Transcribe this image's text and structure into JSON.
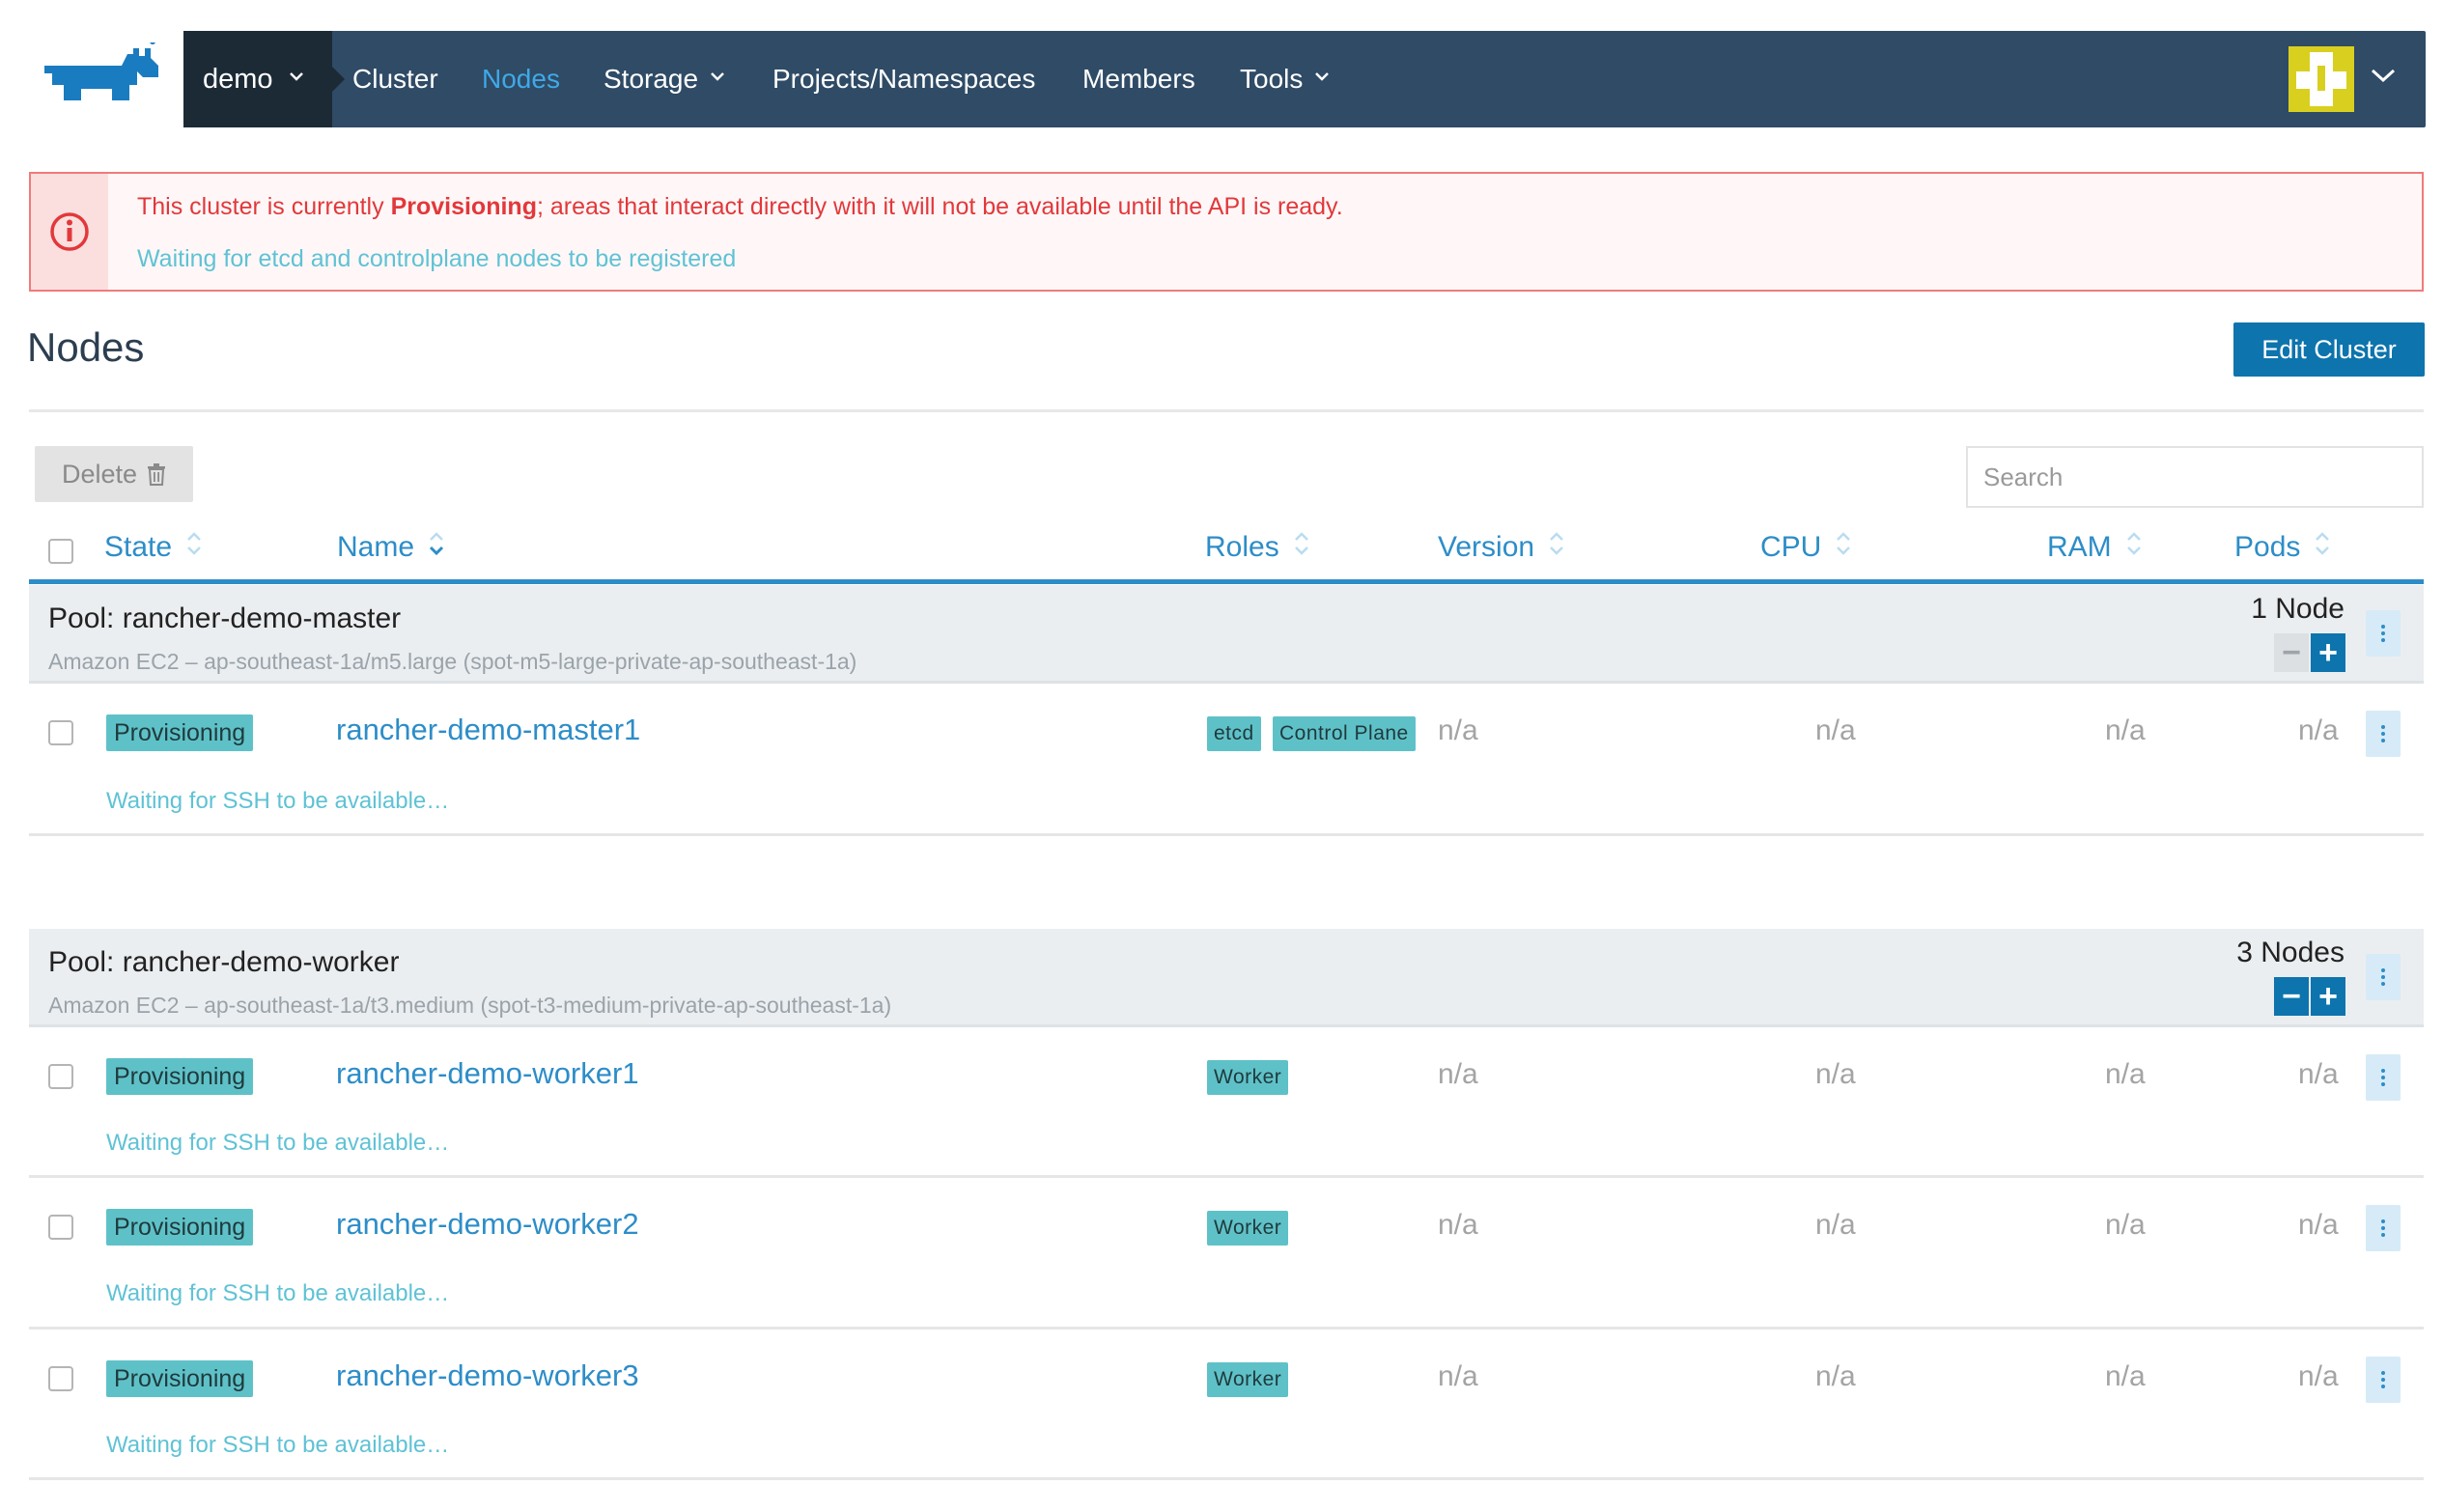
{
  "nav": {
    "cluster": "demo",
    "items": [
      {
        "label": "Cluster"
      },
      {
        "label": "Nodes"
      },
      {
        "label": "Storage"
      },
      {
        "label": "Projects/Namespaces"
      },
      {
        "label": "Members"
      },
      {
        "label": "Tools"
      }
    ]
  },
  "alert": {
    "prefix": "This cluster is currently ",
    "state": "Provisioning",
    "suffix": "; areas that interact directly with it will not be available until the API is ready.",
    "detail": "Waiting for etcd and controlplane nodes to be registered"
  },
  "page": {
    "title": "Nodes",
    "edit_button": "Edit Cluster",
    "delete_button": "Delete",
    "search_placeholder": "Search"
  },
  "columns": [
    "State",
    "Name",
    "Roles",
    "Version",
    "CPU",
    "RAM",
    "Pods"
  ],
  "pools": [
    {
      "name": "Pool: rancher-demo-master",
      "desc": "Amazon EC2 – ap-southeast-1a/m5.large (spot-m5-large-private-ap-southeast-1a)",
      "count": "1 Node",
      "minus_enabled": false,
      "nodes": [
        {
          "state": "Provisioning",
          "name": "rancher-demo-master1",
          "roles": [
            "etcd",
            "Control Plane"
          ],
          "version": "n/a",
          "cpu": "n/a",
          "ram": "n/a",
          "pods": "n/a",
          "message": "Waiting for SSH to be available…"
        }
      ]
    },
    {
      "name": "Pool: rancher-demo-worker",
      "desc": "Amazon EC2 – ap-southeast-1a/t3.medium (spot-t3-medium-private-ap-southeast-1a)",
      "count": "3 Nodes",
      "minus_enabled": true,
      "nodes": [
        {
          "state": "Provisioning",
          "name": "rancher-demo-worker1",
          "roles": [
            "Worker"
          ],
          "version": "n/a",
          "cpu": "n/a",
          "ram": "n/a",
          "pods": "n/a",
          "message": "Waiting for SSH to be available…"
        },
        {
          "state": "Provisioning",
          "name": "rancher-demo-worker2",
          "roles": [
            "Worker"
          ],
          "version": "n/a",
          "cpu": "n/a",
          "ram": "n/a",
          "pods": "n/a",
          "message": "Waiting for SSH to be available…"
        },
        {
          "state": "Provisioning",
          "name": "rancher-demo-worker3",
          "roles": [
            "Worker"
          ],
          "version": "n/a",
          "cpu": "n/a",
          "ram": "n/a",
          "pods": "n/a",
          "message": "Waiting for SSH to be available…"
        }
      ]
    }
  ],
  "colors": {
    "nav_bg": "#2f4b66",
    "nav_active": "#3fa9e8",
    "primary": "#0d74ad",
    "link": "#2d8dc8",
    "badge": "#5fc1c8",
    "error": "#e2383b"
  },
  "icons": {
    "logo": "rancher-cow-logo",
    "alert": "info-circle-icon",
    "delete": "trash-icon",
    "sort": "sort-arrows-icon",
    "menu": "kebab-menu-icon",
    "dropdown": "chevron-down-icon"
  }
}
